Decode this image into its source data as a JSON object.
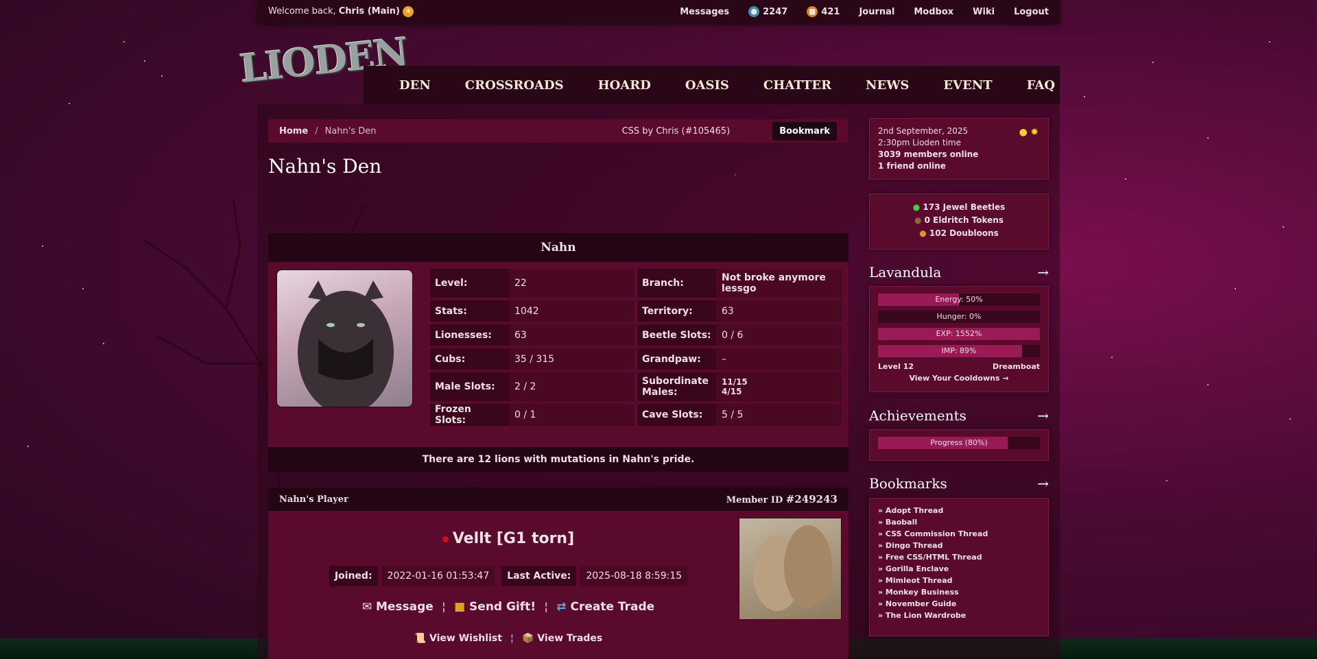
{
  "topbar": {
    "welcome_prefix": "Welcome back,",
    "user": "Chris (Main)",
    "messages": "Messages",
    "jewels": "2247",
    "tokens": "421",
    "journal": "Journal",
    "modbox": "Modbox",
    "wiki": "Wiki",
    "logout": "Logout"
  },
  "logo": {
    "text": "LIODEN"
  },
  "nav": [
    "DEN",
    "CROSSROADS",
    "HOARD",
    "OASIS",
    "CHATTER",
    "NEWS",
    "EVENT",
    "FAQ"
  ],
  "breadcrumb": {
    "home": "Home",
    "sep": "/",
    "current": "Nahn's Den",
    "css_credit": "CSS by Chris (#105465)",
    "bookmark": "Bookmark"
  },
  "page_title": "Nahn's Den",
  "lion": {
    "name": "Nahn",
    "stats": [
      [
        {
          "k": "Level:",
          "v": "22"
        },
        {
          "k": "Branch:",
          "v": "Not broke anymore lessgo"
        }
      ],
      [
        {
          "k": "Stats:",
          "v": "1042"
        },
        {
          "k": "Territory:",
          "v": "63"
        }
      ],
      [
        {
          "k": "Lionesses:",
          "v": "63"
        },
        {
          "k": "Beetle Slots:",
          "v": "0 / 6"
        }
      ],
      [
        {
          "k": "Cubs:",
          "v": "35 / 315"
        },
        {
          "k": "Grandpaw:",
          "v": "–"
        }
      ],
      [
        {
          "k": "Male Slots:",
          "v": "2 / 2"
        },
        {
          "k": "Subordinate Males:",
          "v": "11/15\n4/15"
        }
      ],
      [
        {
          "k": "Frozen Slots:",
          "v": "0 / 1"
        },
        {
          "k": "Cave Slots:",
          "v": "5 / 5"
        }
      ]
    ],
    "mutations_prefix": "There are",
    "mutations_count": "12",
    "mutations_suffix": "lions with mutations in Nahn's pride."
  },
  "player": {
    "header": "Nahn's Player",
    "member_label": "Member ID",
    "member_id": "#249243",
    "name": "Vellt [G1 torn]",
    "joined_label": "Joined:",
    "joined": "2022-01-16 01:53:47",
    "active_label": "Last Active:",
    "active": "2025-08-18 8:59:15",
    "message": "Message",
    "gift": "Send Gift!",
    "trade": "Create Trade",
    "wishlist": "View Wishlist",
    "trades": "View Trades",
    "divider": "¦"
  },
  "sidebar": {
    "date": "2nd September, 2025",
    "time": "2:30pm Lioden time",
    "members": "3039 members online",
    "friends": "1 friend online",
    "currency": [
      "173 Jewel Beetles",
      "0 Eldritch Tokens",
      "102 Doubloons"
    ],
    "pet": {
      "title": "Lavandula",
      "arrow": "→",
      "bars": [
        {
          "label": "Energy: 50%",
          "value": 0.5
        },
        {
          "label": "Hunger: 0%",
          "value": 0.0
        },
        {
          "label": "EXP: 1552%",
          "value": 1.0
        },
        {
          "label": "IMP: 89%",
          "value": 0.89
        }
      ],
      "level": "Level 12",
      "kind": "Dreamboat",
      "cooldowns": "View Your Cooldowns →"
    },
    "achievements": {
      "title": "Achievements",
      "arrow": "→",
      "progress_label": "Progress (80%)",
      "progress": 0.8
    },
    "bookmarks": {
      "title": "Bookmarks",
      "arrow": "→",
      "items": [
        "» Adopt Thread",
        "» Baoball",
        "» CSS Commission Thread",
        "» Dingo Thread",
        "» Free CSS/HTML Thread",
        "» Gorilla Enclave",
        "» Mimleot Thread",
        "» Monkey Business",
        "» November Guide",
        "» The Lion Wardrobe"
      ]
    }
  },
  "colors": {
    "accent": "#5a0a2c",
    "dark": "#240513",
    "bar_fill": "#9a1a55"
  }
}
